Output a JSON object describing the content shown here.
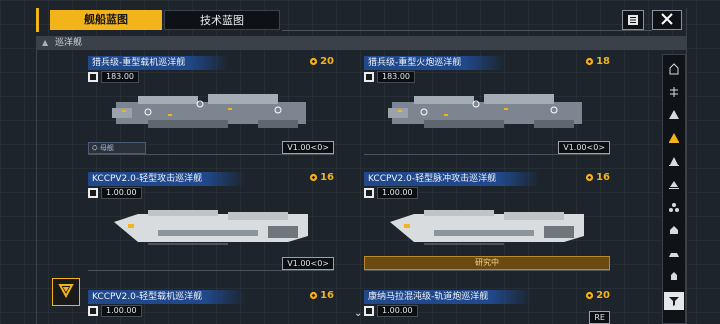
{
  "tabs": [
    {
      "label": "舰船蓝图",
      "active": true
    },
    {
      "label": "技术蓝图",
      "active": false
    }
  ],
  "toolbar": {
    "list_icon": "list-icon",
    "close_icon": "close-icon"
  },
  "section": {
    "label": "巡洋舰"
  },
  "cards": [
    {
      "title": "猎兵级-重型载机巡洋舰",
      "cost": "20",
      "stat_icon": "ship-length-icon",
      "stat": "183.00",
      "tag": "母舰",
      "version": "V1.00<0>",
      "research": ""
    },
    {
      "title": "猎兵级-重型火炮巡洋舰",
      "cost": "18",
      "stat_icon": "ship-length-icon",
      "stat": "183.00",
      "tag": "",
      "version": "V1.00<0>",
      "research": ""
    },
    {
      "title": "KCCPV2.0-轻型攻击巡洋舰",
      "cost": "16",
      "stat_icon": "module-icon",
      "stat": "1.00.00",
      "tag": "",
      "version": "V1.00<0>",
      "research": ""
    },
    {
      "title": "KCCPV2.0-轻型脉冲攻击巡洋舰",
      "cost": "16",
      "stat_icon": "module-icon",
      "stat": "1.00.00",
      "tag": "",
      "version": "",
      "research": "研究中"
    },
    {
      "title": "KCCPV2.0-轻型载机巡洋舰",
      "cost": "16",
      "stat_icon": "module-icon",
      "stat": "1.00.00",
      "tag": "",
      "version": "",
      "research": ""
    },
    {
      "title": "康纳马拉混沌级-轨道炮巡洋舰",
      "cost": "20",
      "stat_icon": "module-icon",
      "stat": "1.00.00",
      "tag": "",
      "version": "RE",
      "research": ""
    }
  ],
  "sidebar": {
    "items": [
      "all-ships-icon",
      "carrier-icon",
      "destroyer-icon",
      "cruiser-icon",
      "frigate-icon",
      "corvette-icon",
      "fighter-icon",
      "battleship-icon",
      "submarine-icon",
      "capital-icon"
    ],
    "filter_icon": "filter-icon"
  },
  "colors": {
    "accent": "#f2b31b",
    "title_bg": "#20488a",
    "bg": "#1d242b"
  }
}
